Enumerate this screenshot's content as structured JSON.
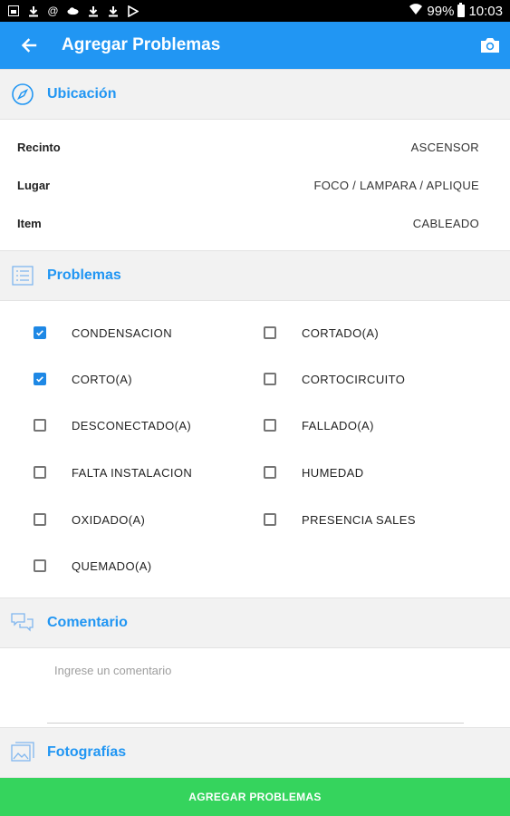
{
  "status_bar": {
    "battery_percent": "99%",
    "time": "10:03",
    "left_icons": [
      "gallery-icon",
      "download-icon",
      "at-icon",
      "cloud-icon",
      "download-icon",
      "download-icon",
      "play-store-icon"
    ]
  },
  "app_bar": {
    "title": "Agregar Problemas"
  },
  "ubicacion": {
    "title": "Ubicación",
    "rows": [
      {
        "label": "Recinto",
        "value": "ASCENSOR"
      },
      {
        "label": "Lugar",
        "value": "FOCO / LAMPARA / APLIQUE"
      },
      {
        "label": "Item",
        "value": "CABLEADO"
      }
    ]
  },
  "problemas": {
    "title": "Problemas",
    "options": [
      {
        "label": "CONDENSACION",
        "checked": true
      },
      {
        "label": "CORTADO(A)",
        "checked": false
      },
      {
        "label": "CORTO(A)",
        "checked": true
      },
      {
        "label": "CORTOCIRCUITO",
        "checked": false
      },
      {
        "label": "DESCONECTADO(A)",
        "checked": false
      },
      {
        "label": "FALLADO(A)",
        "checked": false
      },
      {
        "label": "FALTA INSTALACION",
        "checked": false
      },
      {
        "label": "HUMEDAD",
        "checked": false
      },
      {
        "label": "OXIDADO(A)",
        "checked": false
      },
      {
        "label": "PRESENCIA SALES",
        "checked": false
      },
      {
        "label": "QUEMADO(A)",
        "checked": false
      }
    ]
  },
  "comentario": {
    "title": "Comentario",
    "placeholder": "Ingrese un comentario",
    "value": ""
  },
  "fotografias": {
    "title": "Fotografías"
  },
  "submit_label": "AGREGAR PROBLEMAS",
  "colors": {
    "primary": "#2196f3",
    "checkbox": "#1e88e5",
    "submit": "#35d45d"
  }
}
